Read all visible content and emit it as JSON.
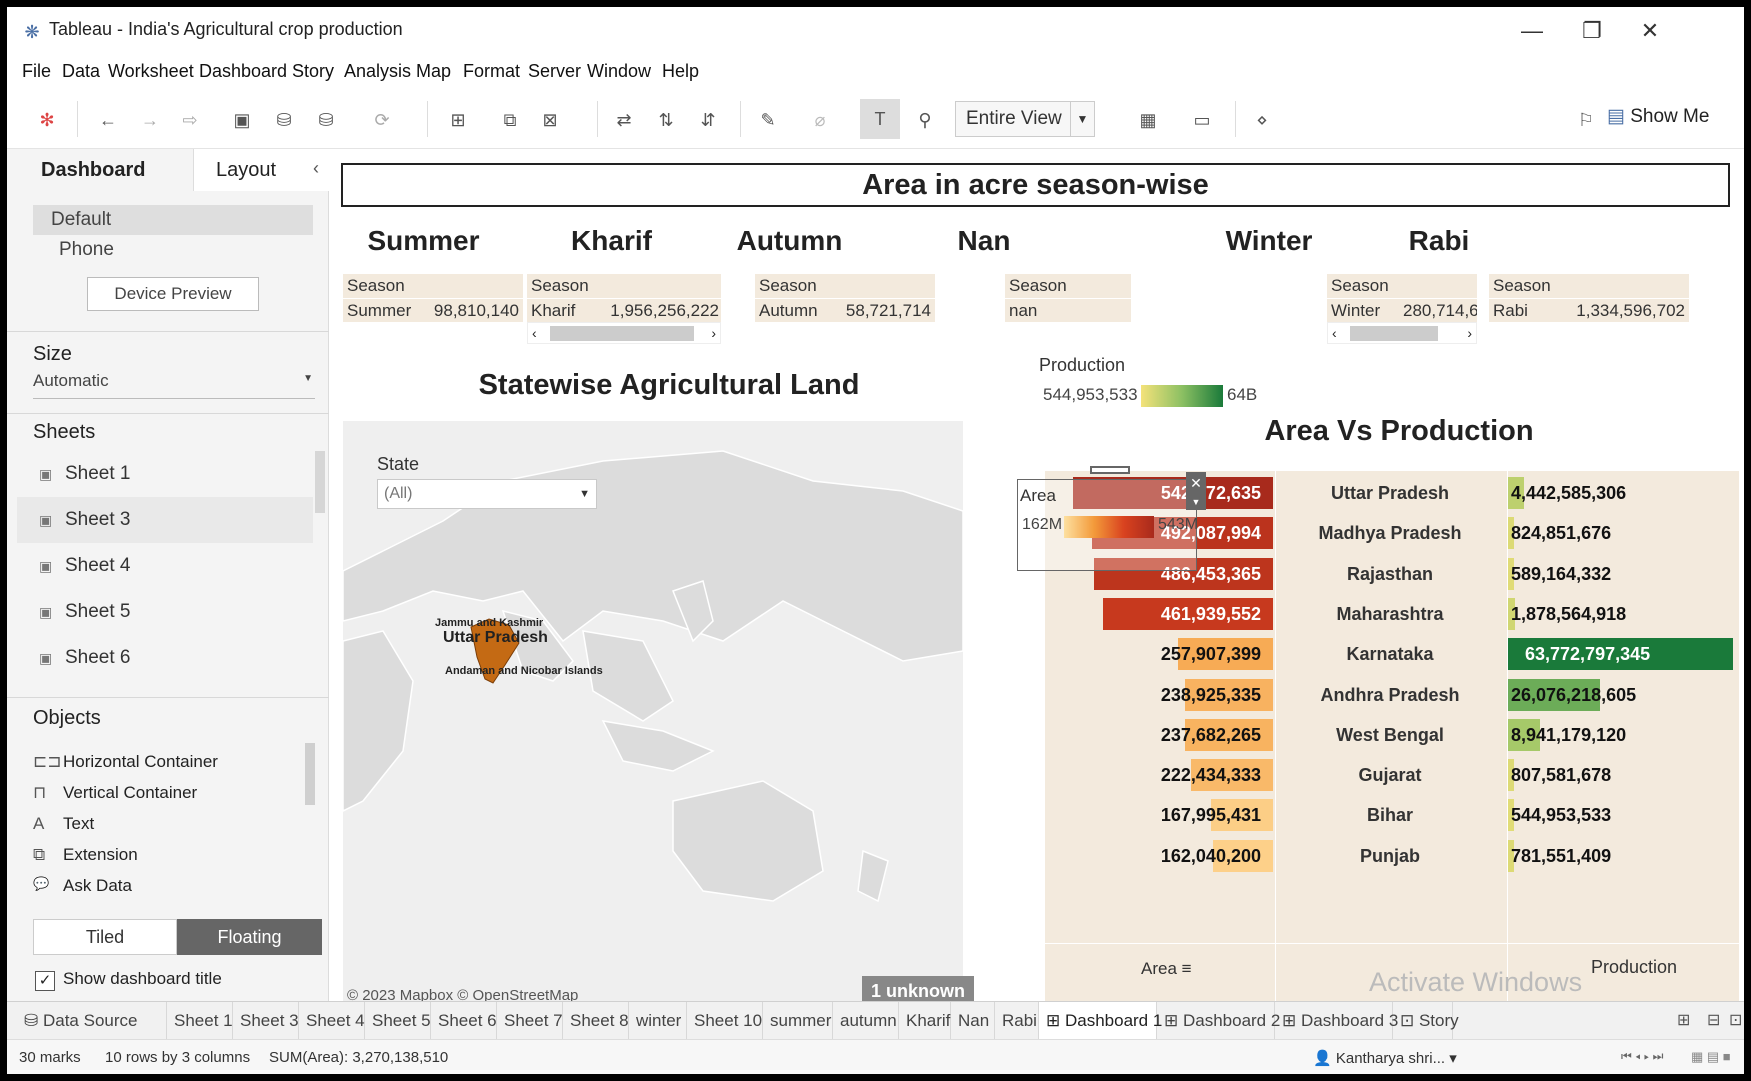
{
  "window": {
    "title": "Tableau - India's Agricultural crop production",
    "minimize": "—",
    "restore": "❐",
    "close": "✕"
  },
  "menu": [
    "File",
    "Data",
    "Worksheet",
    "Dashboard",
    "Story",
    "Analysis",
    "Map",
    "Format",
    "Server",
    "Window",
    "Help"
  ],
  "toolbar": {
    "view": "Entire View",
    "show_me": "Show Me"
  },
  "left_panel": {
    "tabs": [
      "Dashboard",
      "Layout"
    ],
    "collapse": "‹",
    "devices": [
      "Default",
      "Phone"
    ],
    "device_preview": "Device Preview",
    "size_label": "Size",
    "size_value": "Automatic",
    "sheets_label": "Sheets",
    "sheets": [
      "Sheet 1",
      "Sheet 3",
      "Sheet 4",
      "Sheet 5",
      "Sheet 6"
    ],
    "objects_label": "Objects",
    "objects": [
      {
        "icon": "horizontal-container-icon",
        "glyph": "⊏⊐",
        "label": "Horizontal Container"
      },
      {
        "icon": "vertical-container-icon",
        "glyph": "⊓",
        "label": "Vertical Container"
      },
      {
        "icon": "text-icon",
        "glyph": "A",
        "label": "Text"
      },
      {
        "icon": "extension-icon",
        "glyph": "⧉",
        "label": "Extension"
      },
      {
        "icon": "ask-data-icon",
        "glyph": "💬",
        "label": "Ask Data"
      }
    ],
    "tiled": "Tiled",
    "floating": "Floating",
    "show_title": "Show dashboard title",
    "show_title_checked": true
  },
  "dashboard": {
    "title": "Area in acre season-wise",
    "seasons": [
      {
        "heading": "Summer",
        "header": "Season",
        "key": "Summer",
        "value": "98,810,140"
      },
      {
        "heading": "Kharif",
        "header": "Season",
        "key": "Kharif",
        "value": "1,956,256,222"
      },
      {
        "heading": "Autumn",
        "header": "Season",
        "key": "Autumn",
        "value": "58,721,714"
      },
      {
        "heading": "Nan",
        "header": "Season",
        "key": "nan",
        "value": ""
      },
      {
        "heading": "Winter",
        "header": "Season",
        "key": "Winter",
        "value": "280,714,6"
      },
      {
        "heading": "Rabi",
        "header": "Season",
        "key": "Rabi",
        "value": "1,334,596,702"
      }
    ],
    "map": {
      "title": "Statewise Agricultural Land",
      "filter_label": "State",
      "filter_value": "(All)",
      "labels": [
        "Jammu and Kashmir",
        "Uttar Pradesh",
        "Andaman and Nicobar Islands"
      ],
      "attribution": "© 2023 Mapbox © OpenStreetMap",
      "unknown": "1 unknown"
    },
    "production_legend": {
      "label": "Production",
      "min": "544,953,533",
      "max": "64B"
    },
    "area_legend": {
      "label": "Area",
      "min": "162M",
      "max": "543M",
      "close": "✕"
    },
    "avp": {
      "title": "Area Vs Production",
      "area_footer": "Area",
      "production_footer": "Production",
      "rows": [
        {
          "state": "Uttar Pradesh",
          "area": "542,672,635",
          "area_num": 542672635,
          "production": "4,442,585,306",
          "production_num": 4442585306
        },
        {
          "state": "Madhya Pradesh",
          "area": "492,087,994",
          "area_num": 492087994,
          "production": "824,851,676",
          "production_num": 824851676
        },
        {
          "state": "Rajasthan",
          "area": "486,453,365",
          "area_num": 486453365,
          "production": "589,164,332",
          "production_num": 589164332
        },
        {
          "state": "Maharashtra",
          "area": "461,939,552",
          "area_num": 461939552,
          "production": "1,878,564,918",
          "production_num": 1878564918
        },
        {
          "state": "Karnataka",
          "area": "257,907,399",
          "area_num": 257907399,
          "production": "63,772,797,345",
          "production_num": 63772797345
        },
        {
          "state": "Andhra Pradesh",
          "area": "238,925,335",
          "area_num": 238925335,
          "production": "26,076,218,605",
          "production_num": 26076218605
        },
        {
          "state": "West Bengal",
          "area": "237,682,265",
          "area_num": 237682265,
          "production": "8,941,179,120",
          "production_num": 8941179120
        },
        {
          "state": "Gujarat",
          "area": "222,434,333",
          "area_num": 222434333,
          "production": "807,581,678",
          "production_num": 807581678
        },
        {
          "state": "Bihar",
          "area": "167,995,431",
          "area_num": 167995431,
          "production": "544,953,533",
          "production_num": 544953533
        },
        {
          "state": "Punjab",
          "area": "162,040,200",
          "area_num": 162040200,
          "production": "781,551,409",
          "production_num": 781551409
        }
      ]
    },
    "watermark": "Activate Windows"
  },
  "sheet_tabs": [
    "Data Source",
    "Sheet 1",
    "Sheet 3",
    "Sheet 4",
    "Sheet 5",
    "Sheet 6",
    "Sheet 7",
    "Sheet 8",
    "winter",
    "Sheet 10",
    "summer",
    "autumn",
    "Kharif",
    "Nan",
    "Rabi",
    "Dashboard 1",
    "Dashboard 2",
    "Dashboard 3",
    "Story"
  ],
  "active_tab": "Dashboard 1",
  "status": {
    "marks": "30 marks",
    "rows": "10 rows by 3 columns",
    "sum": "SUM(Area): 3,270,138,510",
    "user": "Kantharya shri..."
  },
  "colors": {
    "panel_bg": "#f3eadd",
    "area_dark": "#b5321f",
    "production_green": "#1a7a3a"
  }
}
